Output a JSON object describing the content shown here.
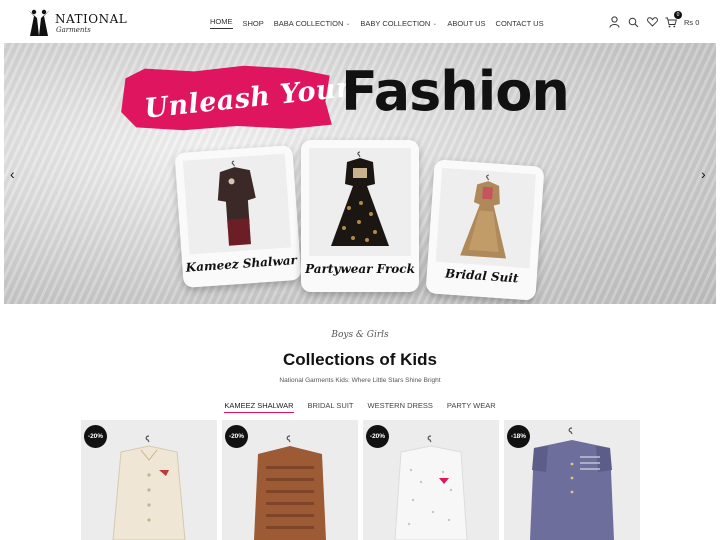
{
  "brand": {
    "name": "NATIONAL",
    "tagline": "Garments"
  },
  "nav": [
    {
      "label": "HOME",
      "active": true,
      "dropdown": false
    },
    {
      "label": "SHOP",
      "active": false,
      "dropdown": false
    },
    {
      "label": "BABA COLLECTION",
      "active": false,
      "dropdown": true
    },
    {
      "label": "BABY COLLECTION",
      "active": false,
      "dropdown": true
    },
    {
      "label": "ABOUT US",
      "active": false,
      "dropdown": false
    },
    {
      "label": "CONTACT US",
      "active": false,
      "dropdown": false
    }
  ],
  "header_icons": {
    "account": "user-icon",
    "search": "search-icon",
    "wishlist": "heart-icon",
    "cart": "cart-icon"
  },
  "cart": {
    "count": "0",
    "total": "Rs 0"
  },
  "hero": {
    "headline_script": "Unleash Your",
    "headline_bold": "Fashion",
    "cards": [
      {
        "label": "Kameez Shalwar"
      },
      {
        "label": "Partywear Frock"
      },
      {
        "label": "Bridal Suit"
      }
    ],
    "prev_icon": "chevron-left-icon",
    "next_icon": "chevron-right-icon",
    "accent": "#e0155f"
  },
  "section": {
    "eyebrow": "Boys & Girls",
    "title": "Collections of Kids",
    "subtitle": "National Garments Kids: Where Little Stars Shine Bright",
    "tabs": [
      {
        "label": "KAMEEZ SHALWAR",
        "active": true
      },
      {
        "label": "BRIDAL SUIT",
        "active": false
      },
      {
        "label": "WESTERN DRESS",
        "active": false
      },
      {
        "label": "PARTY WEAR",
        "active": false
      }
    ]
  },
  "products": [
    {
      "discount": "-20%",
      "color": "#efe6d6"
    },
    {
      "discount": "-20%",
      "color": "#9c5a35"
    },
    {
      "discount": "-20%",
      "color": "#f7f7f7"
    },
    {
      "discount": "-18%",
      "color": "#6d6e9c"
    }
  ]
}
